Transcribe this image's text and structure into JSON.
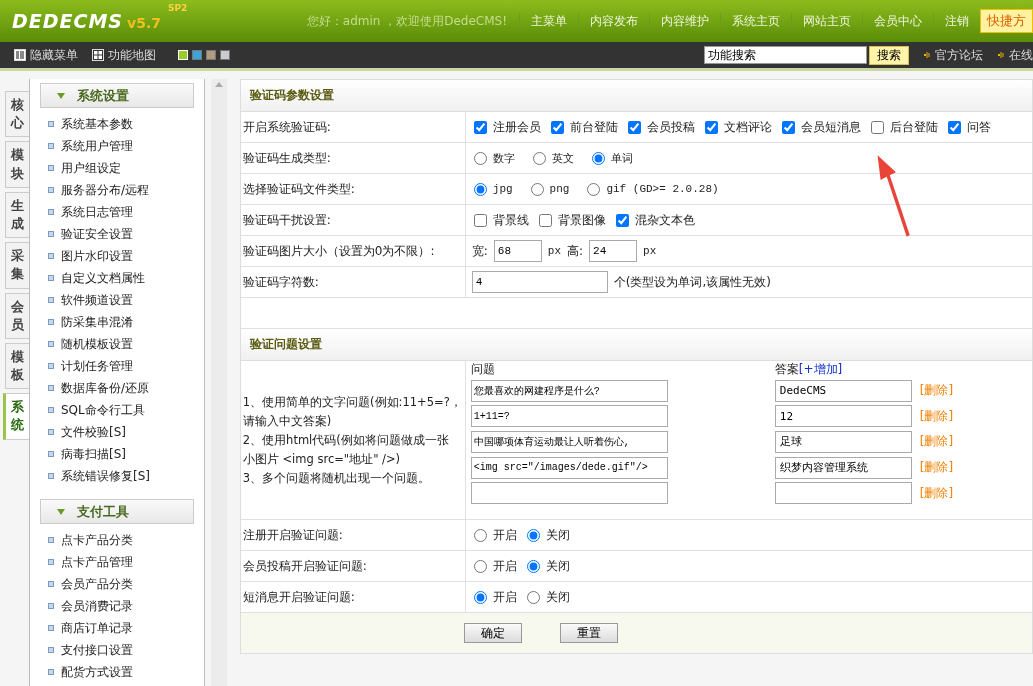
{
  "header": {
    "logo": "DEDECMS",
    "version": "v5.7",
    "tag": "SP2",
    "greeting": "您好：admin ，欢迎使用DedeCMS!",
    "nav": [
      "主菜单",
      "内容发布",
      "内容维护",
      "系统主页",
      "网站主页",
      "会员中心",
      "注销"
    ],
    "quick": "快捷方"
  },
  "toolbar": {
    "items": [
      "隐藏菜单",
      "功能地图"
    ],
    "swatches": [
      {
        "color": "#9ccc2c",
        "selected": true
      },
      {
        "color": "#3aa6dc",
        "selected": false
      },
      {
        "color": "#b09c80",
        "selected": false
      },
      {
        "color": "#c8ccd0",
        "selected": false
      }
    ],
    "search": {
      "value": "功能搜索"
    },
    "search_button": "搜索",
    "links": [
      "官方论坛",
      "在线"
    ]
  },
  "left_tabs": [
    {
      "label": "核心",
      "selected": false
    },
    {
      "label": "模块",
      "selected": false
    },
    {
      "label": "生成",
      "selected": false
    },
    {
      "label": "采集",
      "selected": false
    },
    {
      "label": "会员",
      "selected": false
    },
    {
      "label": "模板",
      "selected": false
    },
    {
      "label": "系统",
      "selected": true
    }
  ],
  "sidebar": {
    "sections": [
      {
        "title": "系统设置",
        "items": [
          "系统基本参数",
          "系统用户管理",
          "用户组设定",
          "服务器分布/远程",
          "系统日志管理",
          "验证安全设置",
          "图片水印设置",
          "自定义文档属性",
          "软件频道设置",
          "防采集串混淆",
          "随机模板设置",
          "计划任务管理",
          "数据库备份/还原",
          "SQL命令行工具",
          "文件校验[S]",
          "病毒扫描[S]",
          "系统错误修复[S]"
        ]
      },
      {
        "title": "支付工具",
        "items": [
          "点卡产品分类",
          "点卡产品管理",
          "会员产品分类",
          "会员消费记录",
          "商店订单记录",
          "支付接口设置",
          "配货方式设置"
        ]
      }
    ]
  },
  "captcha": {
    "title": "验证码参数设置",
    "rows": [
      {
        "kind": "checks",
        "label": "开启系统验证码:",
        "options": [
          {
            "label": "注册会员",
            "checked": true
          },
          {
            "label": "前台登陆",
            "checked": true
          },
          {
            "label": "会员投稿",
            "checked": true
          },
          {
            "label": "文档评论",
            "checked": true
          },
          {
            "label": "会员短消息",
            "checked": true
          },
          {
            "label": "后台登陆",
            "checked": false
          },
          {
            "label": "问答",
            "checked": true
          }
        ]
      },
      {
        "kind": "radios",
        "label": "验证码生成类型:",
        "options": [
          {
            "label": "数字",
            "selected": false
          },
          {
            "label": "英文",
            "selected": false
          },
          {
            "label": "单词",
            "selected": true
          }
        ]
      },
      {
        "kind": "radios",
        "label": "选择验证码文件类型:",
        "options": [
          {
            "label": "jpg",
            "selected": true
          },
          {
            "label": "png",
            "selected": false
          },
          {
            "label": "gif (GD>= 2.0.28)",
            "selected": false
          }
        ]
      },
      {
        "kind": "checks",
        "label": "验证码干扰设置:",
        "options": [
          {
            "label": "背景线",
            "checked": false
          },
          {
            "label": "背景图像",
            "checked": false
          },
          {
            "label": "混杂文本色",
            "checked": true
          }
        ]
      },
      {
        "kind": "size",
        "label": "验证码图片大小（设置为0为不限）:",
        "width_label": "宽:",
        "width_value": "68",
        "width_unit": "px",
        "height_label": "高:",
        "height_value": "24",
        "height_unit": "px"
      },
      {
        "kind": "count",
        "label": "验证码字符数:",
        "value": "4",
        "note": "个(类型设为单词,该属性无效)"
      }
    ]
  },
  "questions": {
    "title": "验证问题设置",
    "help": [
      "1、使用简单的文字问题(例如:11+5=?，",
      "请输入中文答案)",
      "2、使用html代码(例如将问题做成一张",
      "小图片 <img src=\"地址\" />)",
      "3、多个问题将随机出现一个问题。"
    ],
    "question_header": "问题",
    "answer_header": "答案",
    "add_link": "[+增加]",
    "items": [
      {
        "question": "您最喜欢的网建程序是什么?",
        "answer": "DedeCMS",
        "delete": "[删除]"
      },
      {
        "question": "1+11=?",
        "answer": "12",
        "delete": "[删除]"
      },
      {
        "question": "中国哪项体育运动最让人听着伤心,",
        "answer": "足球",
        "delete": "[删除]"
      },
      {
        "question": "<img src=\"/images/dede.gif\"/>",
        "answer": "织梦内容管理系统",
        "delete": "[删除]"
      },
      {
        "delete": "[删除]"
      }
    ],
    "switches": [
      {
        "label": "注册开启验证问题:",
        "options": [
          {
            "label": "开启",
            "selected": false
          },
          {
            "label": "关闭",
            "selected": true
          }
        ]
      },
      {
        "label": "会员投稿开启验证问题:",
        "options": [
          {
            "label": "开启",
            "selected": false
          },
          {
            "label": "关闭",
            "selected": true
          }
        ]
      },
      {
        "label": "短消息开启验证问题:",
        "options": [
          {
            "label": "开启",
            "selected": true
          },
          {
            "label": "关闭",
            "selected": false
          }
        ]
      }
    ]
  },
  "buttons": [
    "确定",
    "重置"
  ]
}
